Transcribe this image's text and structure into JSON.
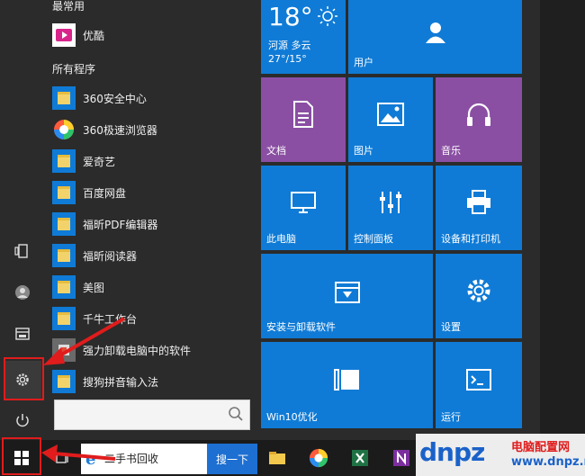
{
  "sections": {
    "frequent": "最常用",
    "all_programs": "所有程序"
  },
  "frequent_apps": [
    {
      "label": "优酷",
      "icon": "youku-icon"
    }
  ],
  "apps": [
    {
      "label": "360安全中心"
    },
    {
      "label": "360极速浏览器"
    },
    {
      "label": "爱奇艺"
    },
    {
      "label": "百度网盘"
    },
    {
      "label": "福昕PDF编辑器"
    },
    {
      "label": "福昕阅读器"
    },
    {
      "label": "美图"
    },
    {
      "label": "千牛工作台"
    },
    {
      "label": "强力卸载电脑中的软件"
    },
    {
      "label": "搜狗拼音输入法"
    }
  ],
  "search": {
    "placeholder": ""
  },
  "weather": {
    "temp": "18°",
    "city": "河源  多云",
    "range": "27°/15°"
  },
  "tiles": {
    "user": "用户",
    "docs": "文档",
    "pictures": "图片",
    "music": "音乐",
    "this_pc": "此电脑",
    "control_panel": "控制面板",
    "devices": "设备和打印机",
    "uninstall": "安装与卸载软件",
    "settings": "设置",
    "win10": "Win10优化",
    "run": "运行"
  },
  "taskbar": {
    "search_text": "二手书回收",
    "search_button": "搜一下"
  },
  "watermark": {
    "logo": "dnpz",
    "top": "电脑配置网",
    "bottom": "www.dnpz.net"
  },
  "colors": {
    "tile_blue": "#0f7bd6",
    "tile_purple": "#8a4fa3",
    "accent_red": "#e01c1c"
  }
}
